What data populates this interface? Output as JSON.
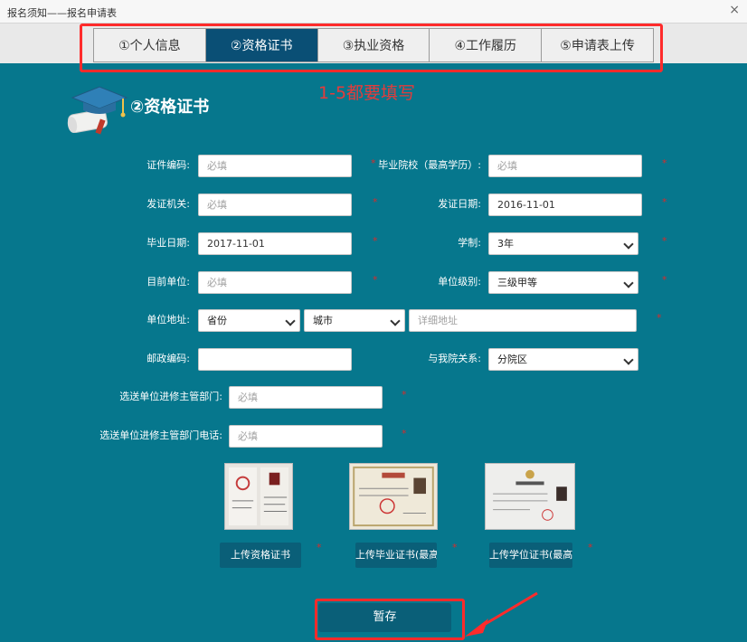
{
  "window": {
    "title": "报名须知——报名申请表",
    "close_glyph": "×"
  },
  "tabs": [
    "①个人信息",
    "②资格证书",
    "③执业资格",
    "④工作履历",
    "⑤申请表上传"
  ],
  "annotation": "1-5都要填写",
  "section_title": "②资格证书",
  "required_mark": "*",
  "fields": {
    "cert_no": {
      "label": "证件编码:",
      "placeholder": "必填"
    },
    "school": {
      "label": "毕业院校（最高学历）:",
      "placeholder": "必填"
    },
    "issuer": {
      "label": "发证机关:",
      "placeholder": "必填"
    },
    "issue_date": {
      "label": "发证日期:",
      "value": "2016-11-01"
    },
    "grad_date": {
      "label": "毕业日期:",
      "value": "2017-11-01"
    },
    "edu_length": {
      "label": "学制:",
      "value": "3年"
    },
    "unit": {
      "label": "目前单位:",
      "placeholder": "必填"
    },
    "unit_level": {
      "label": "单位级别:",
      "value": "三级甲等"
    },
    "unit_address": {
      "label": "单位地址:",
      "province": "省份",
      "city": "城市",
      "placeholder": "详细地址"
    },
    "postcode": {
      "label": "邮政编码:"
    },
    "relation": {
      "label": "与我院关系:",
      "value": "分院区"
    },
    "dept": {
      "label": "选送单位进修主管部门:",
      "placeholder": "必填"
    },
    "dept_phone": {
      "label": "选送单位进修主管部门电话:",
      "placeholder": "必填"
    }
  },
  "uploads": [
    "上传资格证书",
    "上传毕业证书(最高",
    "上传学位证书(最高"
  ],
  "save_label": "暂存",
  "colors": {
    "background": "#06778d",
    "tab_active": "#0a4f75",
    "button": "#0a5f78",
    "highlight": "#ff2b2b",
    "required": "#d62c2c"
  }
}
